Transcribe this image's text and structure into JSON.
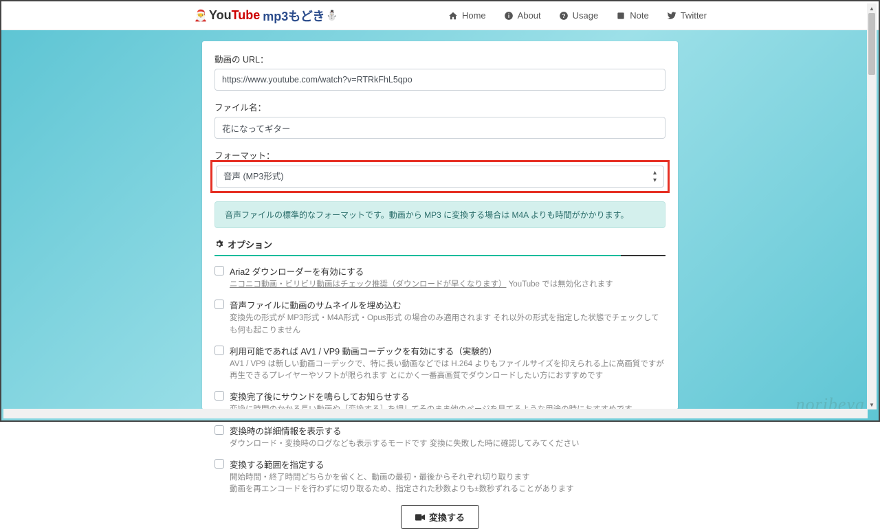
{
  "brand": {
    "you": "You",
    "tube": "Tube",
    "mp3m": "mp3もどき"
  },
  "nav": {
    "home": "Home",
    "about": "About",
    "usage": "Usage",
    "note": "Note",
    "twitter": "Twitter"
  },
  "form": {
    "url_label": "動画の URL：",
    "url_value": "https://www.youtube.com/watch?v=RTRkFhL5qpo",
    "filename_label": "ファイル名：",
    "filename_value": "花になってギター",
    "format_label": "フォーマット：",
    "format_value": "音声 (MP3形式)"
  },
  "alert": "音声ファイルの標準的なフォーマットです。動画から MP3 に変換する場合は M4A よりも時間がかかります。",
  "options": {
    "header": "オプション",
    "items": [
      {
        "title": "Aria2 ダウンローダーを有効にする",
        "desc_link": "ニコニコ動画・ビリビリ動画はチェック推奨（ダウンロードが早くなります）",
        "desc_rest": " YouTube では無効化されます"
      },
      {
        "title": "音声ファイルに動画のサムネイルを埋め込む",
        "desc": "変換先の形式が MP3形式・M4A形式・Opus形式 の場合のみ適用されます それ以外の形式を指定した状態でチェックしても何も起こりません"
      },
      {
        "title": "利用可能であれば AV1 / VP9 動画コーデックを有効にする（実験的）",
        "desc": "AV1 / VP9 は新しい動画コーデックで、特に長い動画などでは H.264 よりもファイルサイズを抑えられる上に高画質ですが\n再生できるプレイヤーやソフトが限られます とにかく一番高画質でダウンロードしたい方におすすめです"
      },
      {
        "title": "変換完了後にサウンドを鳴らしてお知らせする",
        "desc": "変換に時間のかかる長い動画や［変換する］を押してそのまま他のページを見てるような用途の時におすすめです"
      },
      {
        "title": "変換時の詳細情報を表示する",
        "desc": "ダウンロード・変換時のログなども表示するモードです 変換に失敗した時に確認してみてください"
      },
      {
        "title": "変換する範囲を指定する",
        "desc": "開始時間・終了時間どちらかを省くと、動画の最初・最後からそれぞれ切り取ります\n動画を再エンコードを行わずに切り取るため、指定された秒数よりも±数秒ずれることがあります"
      }
    ]
  },
  "convert_button": "変換する",
  "watermark": "noribeya"
}
